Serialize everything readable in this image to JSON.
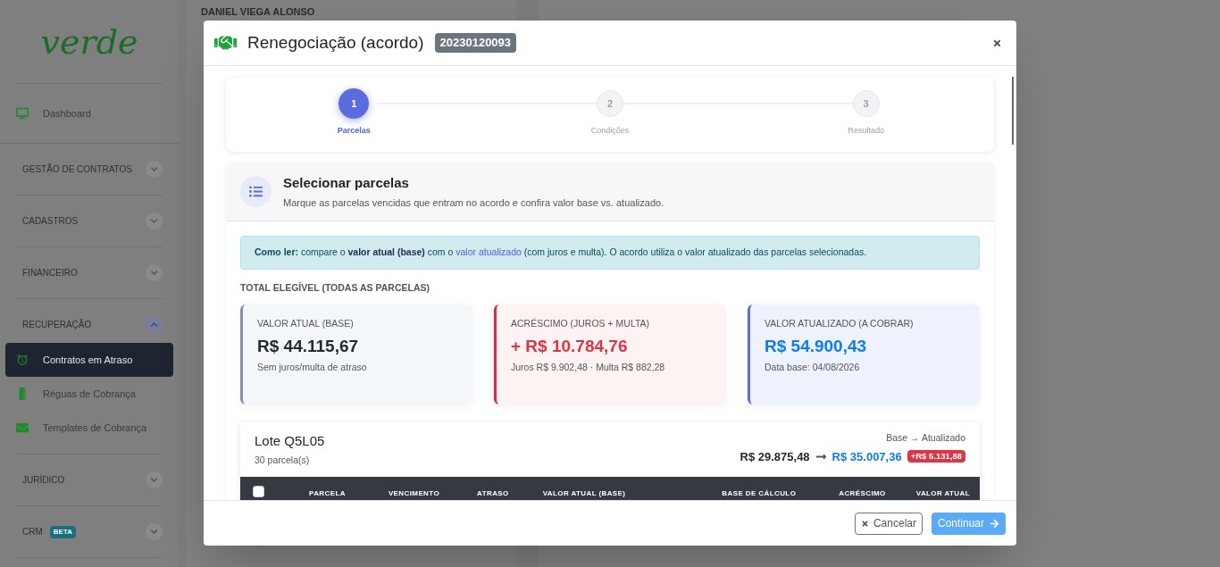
{
  "background": {
    "customer_name": "DANIEL VIEGA ALONSO"
  },
  "sidebar": {
    "logo": "verde",
    "items": [
      {
        "kind": "link",
        "label": "Dashboard",
        "selected": false
      },
      {
        "kind": "section",
        "label": "GESTÃO DE CONTRATOS",
        "expanded": false
      },
      {
        "kind": "section",
        "label": "CADASTROS",
        "expanded": false
      },
      {
        "kind": "section",
        "label": "FINANCEIRO",
        "expanded": false
      },
      {
        "kind": "section",
        "label": "RECUPERAÇÃO",
        "expanded": true,
        "children": [
          {
            "kind": "link",
            "label": "Contratos em Atraso",
            "selected": true
          },
          {
            "kind": "link",
            "label": "Réguas de Cobrança",
            "selected": false
          },
          {
            "kind": "link",
            "label": "Templates de Cobrança",
            "selected": false
          }
        ]
      },
      {
        "kind": "section",
        "label": "JURÍDICO",
        "expanded": false
      },
      {
        "kind": "section",
        "label": "CRM",
        "badge": "BETA",
        "expanded": false
      }
    ]
  },
  "modal": {
    "title": "Renegociação (acordo)",
    "badge": "20230120093",
    "steps": [
      {
        "number": "1",
        "label": "Parcelas",
        "selected": true
      },
      {
        "number": "2",
        "label": "Condições",
        "selected": false
      },
      {
        "number": "3",
        "label": "Resultado",
        "selected": false
      }
    ],
    "section": {
      "title": "Selecionar parcelas",
      "subtitle": "Marque as parcelas vencidas que entram no acordo e confira valor base vs. atualizado."
    },
    "info": [
      {
        "kind": "label",
        "text": "Como ler:"
      },
      {
        "kind": "plain",
        "text": " compare o "
      },
      {
        "kind": "strong",
        "text": "valor atual (base)"
      },
      {
        "kind": "plain",
        "text": " com o "
      },
      {
        "kind": "link",
        "text": "valor atualizado"
      },
      {
        "kind": "plain",
        "text": " (com juros e multa). O acordo utiliza o valor atualizado das parcelas selecionadas."
      }
    ],
    "totals_heading": "TOTAL ELEGÍVEL (TODAS AS PARCELAS)",
    "totals": [
      {
        "kind": "neutral",
        "label": "VALOR ATUAL (BASE)",
        "value": "R$ 44.115,67",
        "note": "Sem juros/multa de atraso"
      },
      {
        "kind": "danger",
        "label": "ACRÉSCIMO (JUROS + MULTA)",
        "value": "+ R$ 10.784,76",
        "note": "Juros R$ 9.902,48 · Multa R$ 882,28"
      },
      {
        "kind": "primary",
        "label": "VALOR ATUALIZADO (A COBRAR)",
        "value": "R$ 54.900,43",
        "note": "Data base: 04/08/2026"
      }
    ],
    "lot": {
      "title": "Lote Q5L05",
      "count": "30 parcela(s)",
      "caption": "Base → Atualizado",
      "base": "R$ 29.875,48",
      "updated": "R$ 35.007,36",
      "difference": "+R$ 5.131,88",
      "table": {
        "select_all": {
          "checked": false
        },
        "columns": [
          "PARCELA",
          "VENCIMENTO",
          "ATRASO",
          "VALOR ATUAL (BASE)",
          "BASE DE CÁLCULO",
          "ACRÉSCIMO",
          "VALOR ATUAL"
        ]
      }
    }
  },
  "footer": {
    "buttons": [
      {
        "kind": "secondary",
        "label": "Cancelar"
      },
      {
        "kind": "primary",
        "label": "Continuar"
      }
    ]
  }
}
